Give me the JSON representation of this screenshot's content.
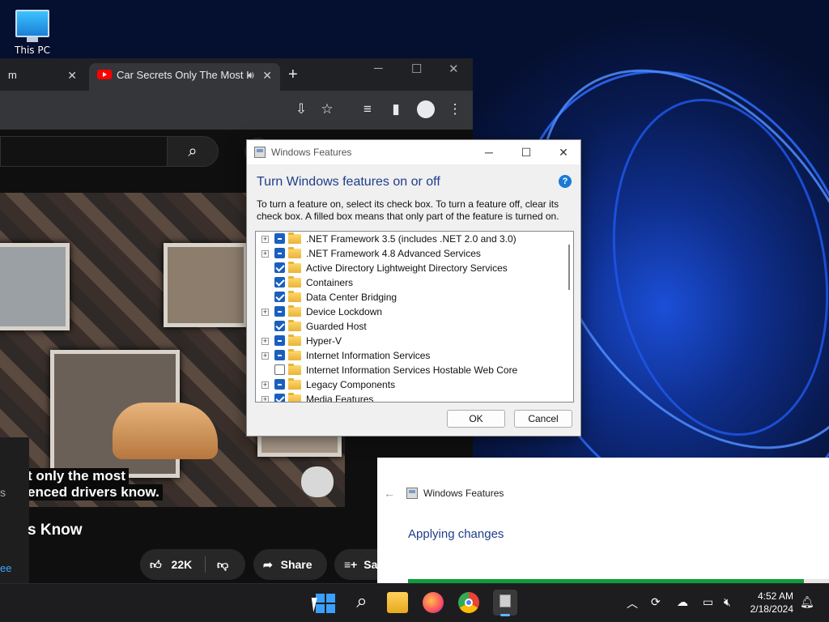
{
  "desktop": {
    "icons": [
      {
        "label": "This PC"
      }
    ]
  },
  "chrome": {
    "tabs": [
      {
        "label": "m"
      },
      {
        "label": "Car Secrets Only The Most I"
      }
    ],
    "video": {
      "captions": [
        "t only the most",
        "enced drivers know."
      ],
      "title": "s Know",
      "left_char": "s",
      "like_count": "22K",
      "share_label": "Share",
      "save_label": "Sa",
      "see_more": "ee"
    }
  },
  "windows_features": {
    "title": "Windows Features",
    "heading": "Turn Windows features on or off",
    "description": "To turn a feature on, select its check box. To turn a feature off, clear its check box. A filled box means that only part of the feature is turned on.",
    "features": [
      {
        "label": ".NET Framework 3.5 (includes .NET 2.0 and 3.0)",
        "state": "partial",
        "expandable": true
      },
      {
        "label": ".NET Framework 4.8 Advanced Services",
        "state": "partial",
        "expandable": true
      },
      {
        "label": "Active Directory Lightweight Directory Services",
        "state": "checked",
        "expandable": false
      },
      {
        "label": "Containers",
        "state": "checked",
        "expandable": false
      },
      {
        "label": "Data Center Bridging",
        "state": "checked",
        "expandable": false
      },
      {
        "label": "Device Lockdown",
        "state": "partial",
        "expandable": true
      },
      {
        "label": "Guarded Host",
        "state": "checked",
        "expandable": false
      },
      {
        "label": "Hyper-V",
        "state": "partial",
        "expandable": true
      },
      {
        "label": "Internet Information Services",
        "state": "partial",
        "expandable": true
      },
      {
        "label": "Internet Information Services Hostable Web Core",
        "state": "unchecked",
        "expandable": false
      },
      {
        "label": "Legacy Components",
        "state": "partial",
        "expandable": true
      },
      {
        "label": "Media Features",
        "state": "checked",
        "expandable": true
      }
    ],
    "ok_label": "OK",
    "cancel_label": "Cancel",
    "help_glyph": "?"
  },
  "applying": {
    "title": "Windows Features",
    "message": "Applying changes",
    "progress": 0.94
  },
  "taskbar": {
    "time": "4:52 AM",
    "date": "2/18/2024"
  },
  "colors": {
    "accent": "#1a5fbf",
    "heading": "#1e3d8a",
    "progress": "#0f9d3a",
    "youtube": "#ff0000"
  }
}
